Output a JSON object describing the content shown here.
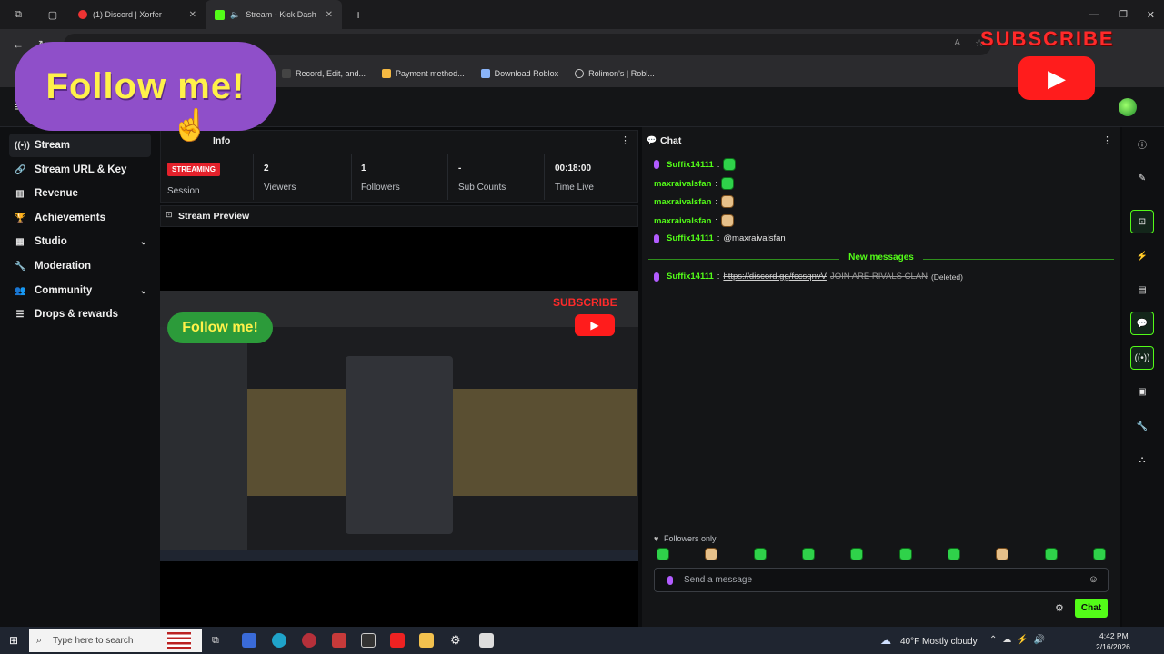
{
  "browser": {
    "tabs": [
      {
        "label": "(1) Discord | Xorfer"
      },
      {
        "label": "Stream - Kick Dash"
      }
    ],
    "address": "",
    "bookmarks": [
      {
        "label": "Record, Edit, and..."
      },
      {
        "label": "Payment method..."
      },
      {
        "label": "Download Roblox"
      },
      {
        "label": "Rolimon's | Robl..."
      }
    ]
  },
  "overlay": {
    "follow": "Follow me!",
    "subscribe": "SUBSCRIBE",
    "mini_follow": "Follow me!",
    "mini_subscribe": "SUBSCRIBE"
  },
  "sidebar": {
    "items": [
      {
        "label": "Stream",
        "icon": "broadcast-icon"
      },
      {
        "label": "Stream URL & Key",
        "icon": "link-icon"
      },
      {
        "label": "Revenue",
        "icon": "chart-icon"
      },
      {
        "label": "Achievements",
        "icon": "trophy-icon"
      },
      {
        "label": "Studio",
        "icon": "grid-icon"
      },
      {
        "label": "Moderation",
        "icon": "wrench-icon"
      },
      {
        "label": "Community",
        "icon": "people-icon"
      },
      {
        "label": "Drops & rewards",
        "icon": "list-icon"
      }
    ]
  },
  "session": {
    "title": "Info",
    "badge": "STREAMING",
    "stats": [
      {
        "value": "",
        "label": "Session"
      },
      {
        "value": "2",
        "label": "Viewers"
      },
      {
        "value": "1",
        "label": "Followers"
      },
      {
        "value": "-",
        "label": "Sub Counts"
      },
      {
        "value": "00:18:00",
        "label": "Time Live"
      }
    ]
  },
  "preview": {
    "title": "Stream Preview"
  },
  "chat": {
    "title": "Chat",
    "messages": [
      {
        "user": "Suffix14111",
        "text": "",
        "mic": true
      },
      {
        "user": "maxraivalsfan",
        "text": "",
        "mic": false
      },
      {
        "user": "maxraivalsfan",
        "text": "",
        "mic": false
      },
      {
        "user": "maxraivalsfan",
        "text": "",
        "mic": false
      },
      {
        "user": "Suffix14111",
        "text": "@maxraivalsfan",
        "mic": true
      }
    ],
    "new_messages": "New messages",
    "deleted": {
      "user": "Suffix14111",
      "link": "https://discord.gg/fccsqnvV",
      "text": "JOIN ARE RIVALS CLAN",
      "tag": "(Deleted)"
    },
    "followers_only": "Followers only",
    "placeholder": "Send a message",
    "send_label": "Chat"
  },
  "taskbar": {
    "search_placeholder": "Type here to search",
    "weather": "40°F  Mostly cloudy",
    "time": "4:42 PM",
    "date": "2/16/2026"
  },
  "colors": {
    "accent": "#53fc18",
    "live": "#e4212b",
    "overlay_purple": "#8f4fc9"
  }
}
